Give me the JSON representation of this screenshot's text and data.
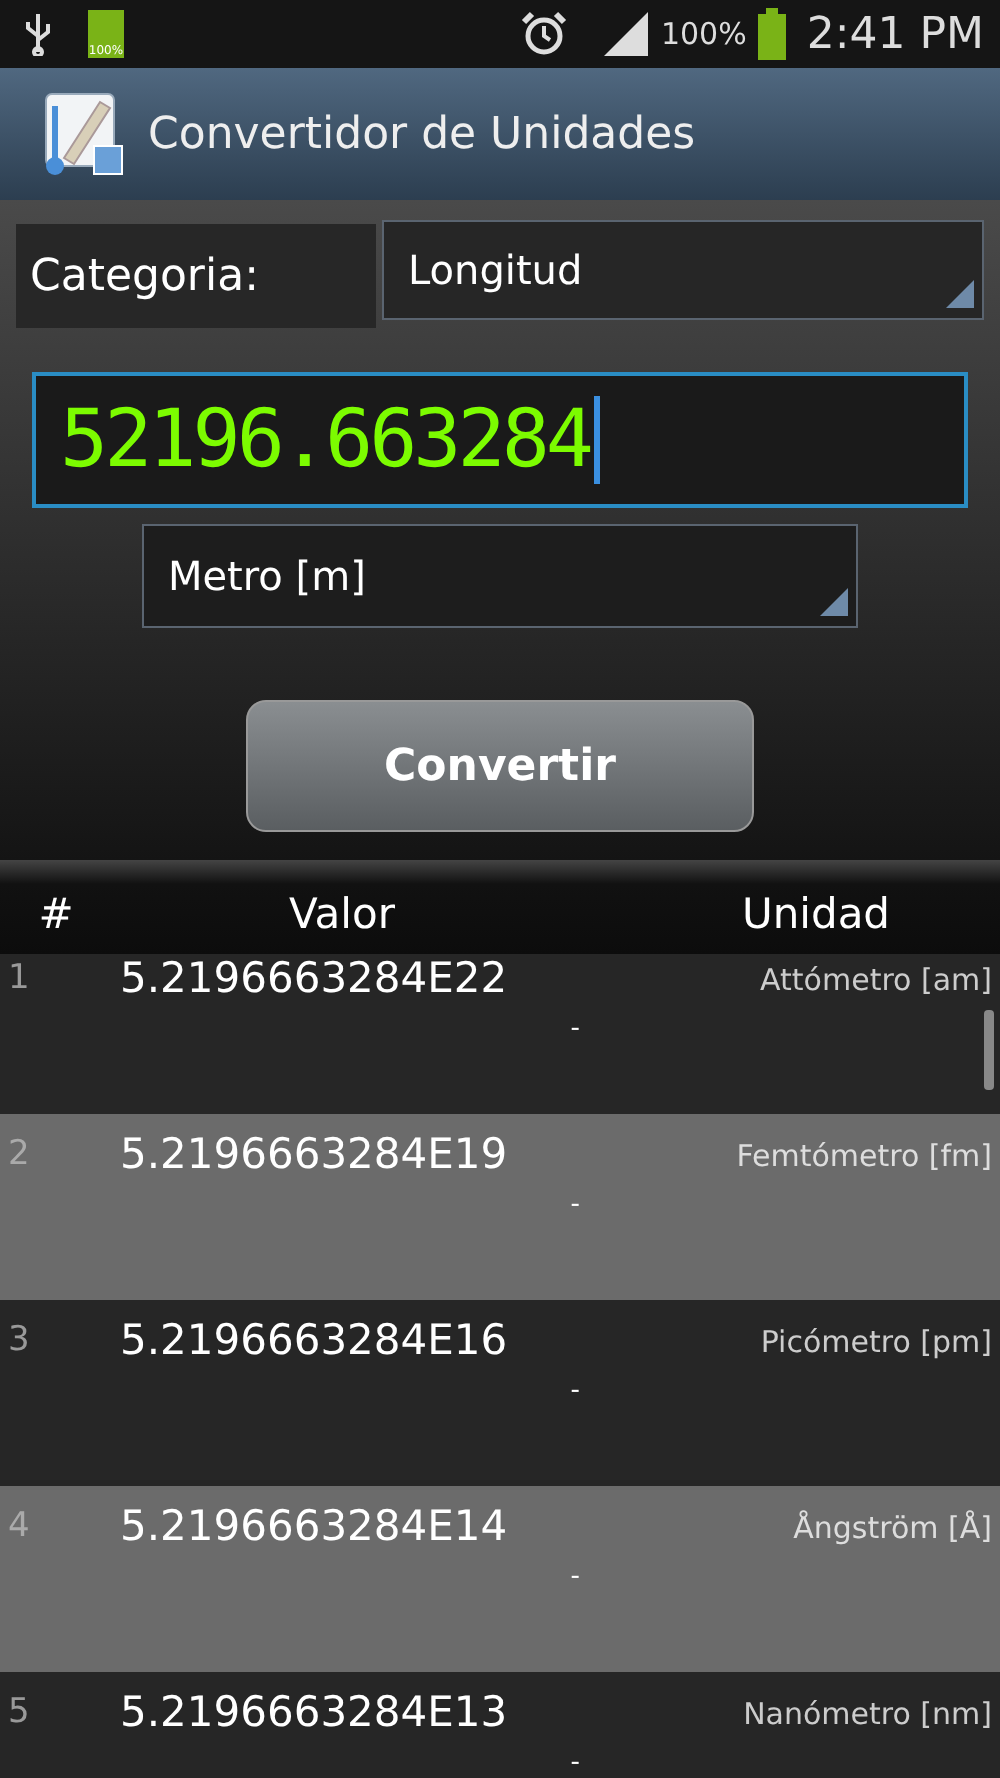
{
  "status_bar": {
    "battery_icon_label": "100%",
    "battery_percent": "100%",
    "time": "2:41 PM"
  },
  "app_bar": {
    "title": "Convertidor de Unidades"
  },
  "form": {
    "category_label": "Categoria:",
    "category_value": "Longitud",
    "input_value": "52196.663284",
    "unit_value": "Metro [m]",
    "button": "Convertir"
  },
  "table": {
    "columns": [
      "#",
      "Valor",
      "Unidad"
    ],
    "rows": [
      {
        "index": "1",
        "value": "5.2196663284E22",
        "note": "-",
        "unit": "Attómetro [am]"
      },
      {
        "index": "2",
        "value": "5.2196663284E19",
        "note": "-",
        "unit": "Femtómetro [fm]"
      },
      {
        "index": "3",
        "value": "5.2196663284E16",
        "note": "-",
        "unit": "Picómetro [pm]"
      },
      {
        "index": "4",
        "value": "5.2196663284E14",
        "note": "-",
        "unit": "Ångström [Å]"
      },
      {
        "index": "5",
        "value": "5.2196663284E13",
        "note": "-",
        "unit": "Nanómetro [nm]"
      }
    ]
  }
}
